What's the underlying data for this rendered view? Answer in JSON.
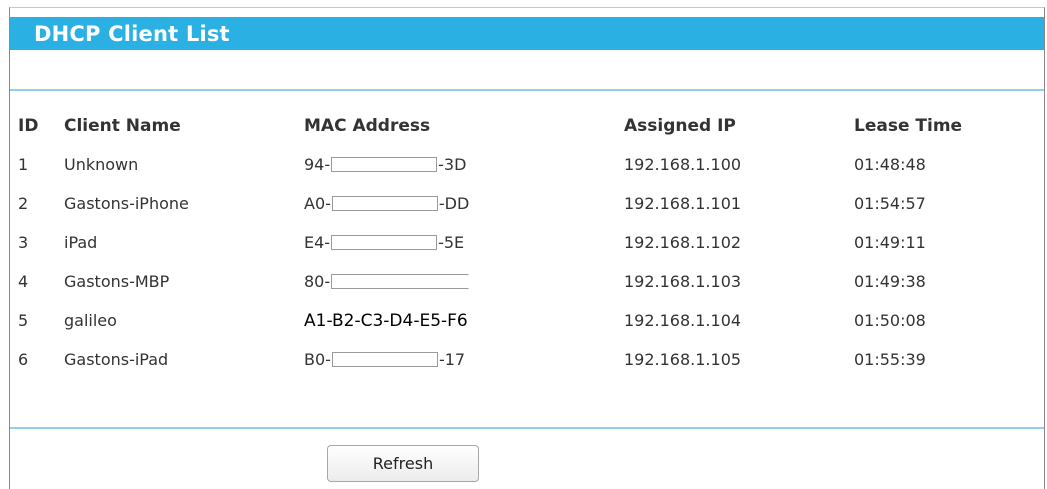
{
  "title": "DHCP Client List",
  "columns": {
    "id": "ID",
    "client_name": "Client Name",
    "mac_address": "MAC Address",
    "assigned_ip": "Assigned IP",
    "lease_time": "Lease Time"
  },
  "rows": [
    {
      "id": "1",
      "client_name": "Unknown",
      "mac_prefix": "94-",
      "mac_suffix": "-3D",
      "assigned_ip": "192.168.1.100",
      "lease_time": "01:48:48"
    },
    {
      "id": "2",
      "client_name": "Gastons-iPhone",
      "mac_prefix": "A0-",
      "mac_suffix": "-DD",
      "assigned_ip": "192.168.1.101",
      "lease_time": "01:54:57"
    },
    {
      "id": "3",
      "client_name": "iPad",
      "mac_prefix": "E4-",
      "mac_suffix": "-5E",
      "assigned_ip": "192.168.1.102",
      "lease_time": "01:49:11"
    },
    {
      "id": "4",
      "client_name": "Gastons-MBP",
      "mac_prefix": "80-",
      "mac_suffix": "",
      "assigned_ip": "192.168.1.103",
      "lease_time": "01:49:38"
    },
    {
      "id": "5",
      "client_name": "galileo",
      "mac_full": "A1-B2-C3-D4-E5-F6",
      "assigned_ip": "192.168.1.104",
      "lease_time": "01:50:08"
    },
    {
      "id": "6",
      "client_name": "Gastons-iPad",
      "mac_prefix": "B0-",
      "mac_suffix": "-17",
      "assigned_ip": "192.168.1.105",
      "lease_time": "01:55:39"
    }
  ],
  "refresh_label": "Refresh",
  "colors": {
    "title_bar": "#2ab0e3",
    "divider": "#8fd0ef"
  }
}
